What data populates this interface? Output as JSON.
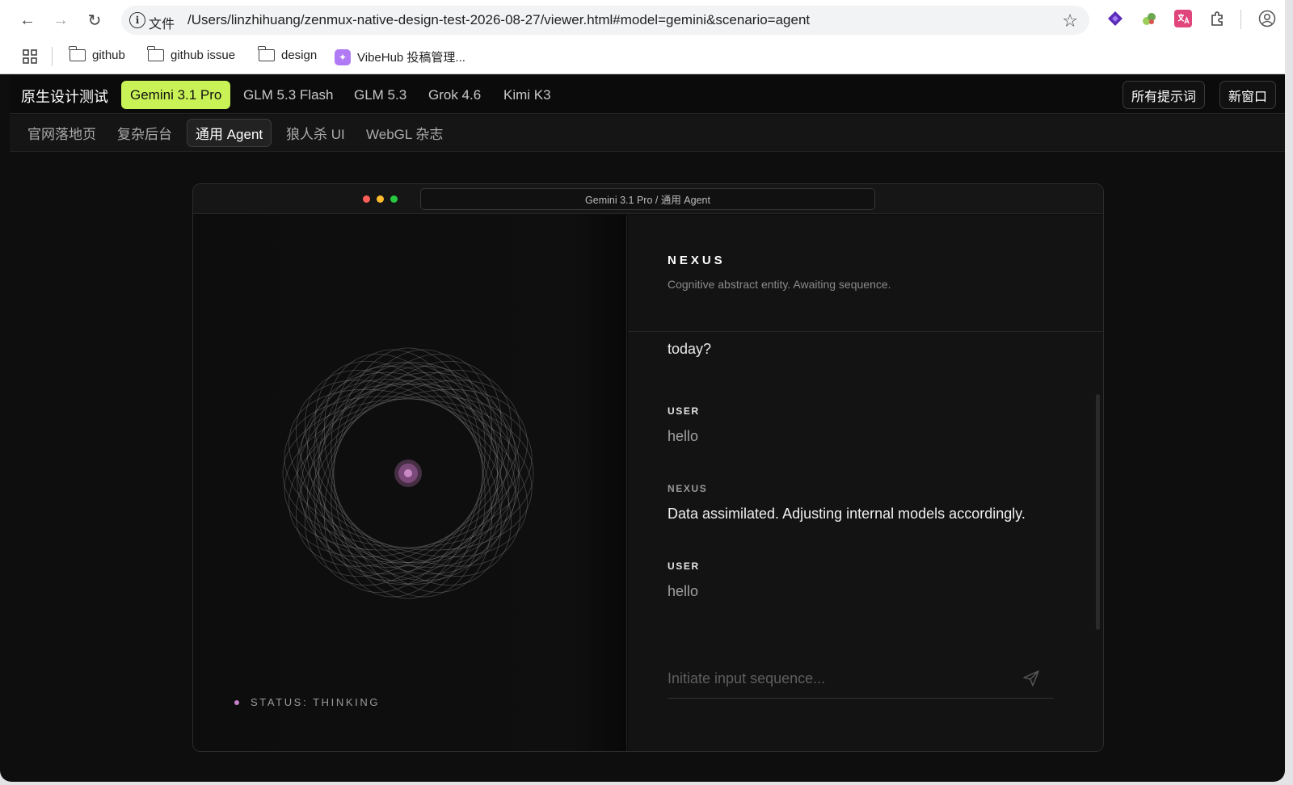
{
  "browser": {
    "nav": {
      "back": "←",
      "forward": "→",
      "reload": "↻"
    },
    "omnibox": {
      "info": "i",
      "scheme_label": "文件",
      "url": "/Users/linzhihuang/zenmux-native-design-test-2026-08-27/viewer.html#model=gemini&scenario=agent",
      "star": "☆"
    },
    "extensions": [
      "diamond-icon",
      "puzzle-piece-icon",
      "translate-icon",
      "extensions-icon",
      "profile-icon"
    ]
  },
  "bookmarks": {
    "apps_icon": "apps-grid-icon",
    "items": [
      {
        "label": "github"
      },
      {
        "label": "github issue"
      },
      {
        "label": "design"
      },
      {
        "label": "VibeHub 投稿管理..."
      }
    ]
  },
  "header": {
    "title": "原生设计测试",
    "models": [
      "Gemini 3.1 Pro",
      "GLM 5.3 Flash",
      "GLM 5.3",
      "Grok 4.6",
      "Kimi K3"
    ],
    "active_model": "Gemini 3.1 Pro",
    "all_prompts_label": "所有提示词",
    "new_window_label": "新窗口"
  },
  "scenarios": {
    "items": [
      "官网落地页",
      "复杂后台",
      "通用 Agent",
      "狼人杀 UI",
      "WebGL 杂志"
    ],
    "active": "通用 Agent"
  },
  "frame": {
    "address": "Gemini 3.1 Pro / 通用 Agent",
    "status": "STATUS: THINKING",
    "agent": {
      "name": "NEXUS",
      "tagline": "Cognitive abstract entity. Awaiting sequence."
    },
    "messages": [
      {
        "role": "NEXUS",
        "text": "today?"
      },
      {
        "role": "USER",
        "text": "hello"
      },
      {
        "role": "NEXUS",
        "text": "Data assimilated. Adjusting internal models accordingly."
      },
      {
        "role": "USER",
        "text": "hello"
      }
    ],
    "input_placeholder": "Initiate input sequence..."
  },
  "colors": {
    "accent": "#c9f256",
    "status_dot": "#c77fc8",
    "core": "#b06aa8",
    "traffic": [
      "#ff5f57",
      "#febc2e",
      "#28c840"
    ]
  }
}
